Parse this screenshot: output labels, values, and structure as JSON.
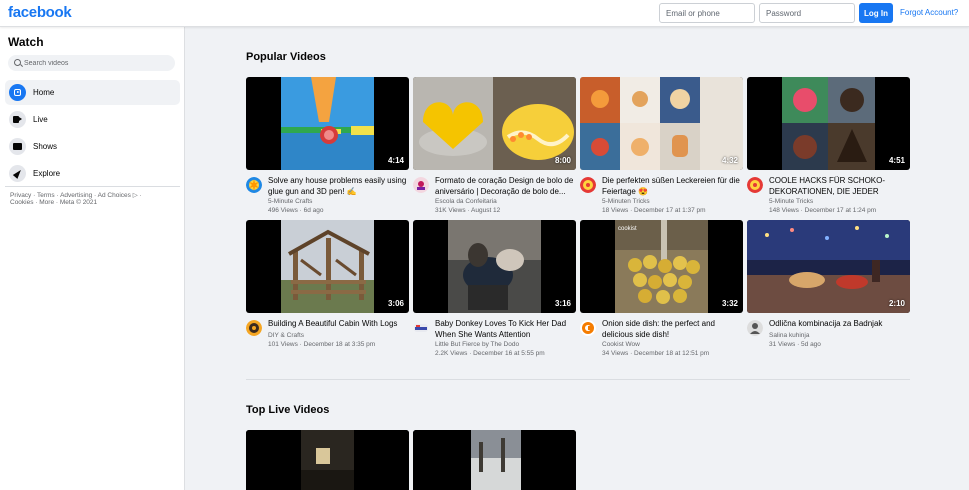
{
  "header": {
    "logo": "facebook",
    "email_placeholder": "Email or phone",
    "password_placeholder": "Password",
    "login_label": "Log In",
    "forgot_label": "Forgot Account?"
  },
  "sidebar": {
    "title": "Watch",
    "search_placeholder": "Search videos",
    "items": [
      {
        "label": "Home",
        "icon": "play-icon",
        "active": true
      },
      {
        "label": "Live",
        "icon": "live-camera-icon",
        "active": false
      },
      {
        "label": "Shows",
        "icon": "shows-icon",
        "active": false
      },
      {
        "label": "Explore",
        "icon": "explore-rocket-icon",
        "active": false
      }
    ],
    "footer_line1": "Privacy · Terms · Advertising · Ad Choices ▷ ·",
    "footer_line2": "Cookies · More · Meta © 2021"
  },
  "main": {
    "popular_title": "Popular Videos",
    "live_title": "Top Live Videos",
    "videos": [
      {
        "title": "Solve any house problems easily using glue gun and 3D pen! ✍",
        "channel": "5-Minute Crafts",
        "meta": "496 Views · 6d ago",
        "duration": "4:14"
      },
      {
        "title": "Formato de coração Design de bolo de aniversário | Decoração de bolo de...",
        "channel": "Escola da Confeitaria",
        "meta": "31K Views · August 12",
        "duration": "8:00"
      },
      {
        "title": "Die perfekten süßen Leckereien für die Feiertage 😍",
        "channel": "5-Minuten Tricks",
        "meta": "18 Views · December 17 at 1:37 pm",
        "duration": "4:32"
      },
      {
        "title": "COOLE HACKS FÜR SCHOKO-DEKORATIONEN, DIE JEDER MACHEN...",
        "channel": "5-Minute Tricks",
        "meta": "148 Views · December 17 at 1:24 pm",
        "duration": "4:51"
      },
      {
        "title": "Building A Beautiful Cabin With Logs",
        "channel": "DIY & Crafts",
        "meta": "101 Views · December 18 at 3:35 pm",
        "duration": "3:06"
      },
      {
        "title": "Baby Donkey Loves To Kick Her Dad When She Wants Attention",
        "channel": "Little But Fierce by The Dodo",
        "meta": "2.2K Views · December 16 at 5:55 pm",
        "duration": "3:16"
      },
      {
        "title": "Onion side dish: the perfect and delicious side dish!",
        "channel": "Cookist Wow",
        "meta": "34 Views · December 18 at 12:51 pm",
        "duration": "3:32"
      },
      {
        "title": "Odlična kombinacija za Badnjak",
        "channel": "Salina kuhinja",
        "meta": "31 Views · 5d ago",
        "duration": "2:10"
      }
    ],
    "thumb_overlay_1": "cookist"
  },
  "colors": {
    "brand": "#1877f2",
    "background": "#f0f2f5",
    "secondary_text": "#65676b"
  }
}
